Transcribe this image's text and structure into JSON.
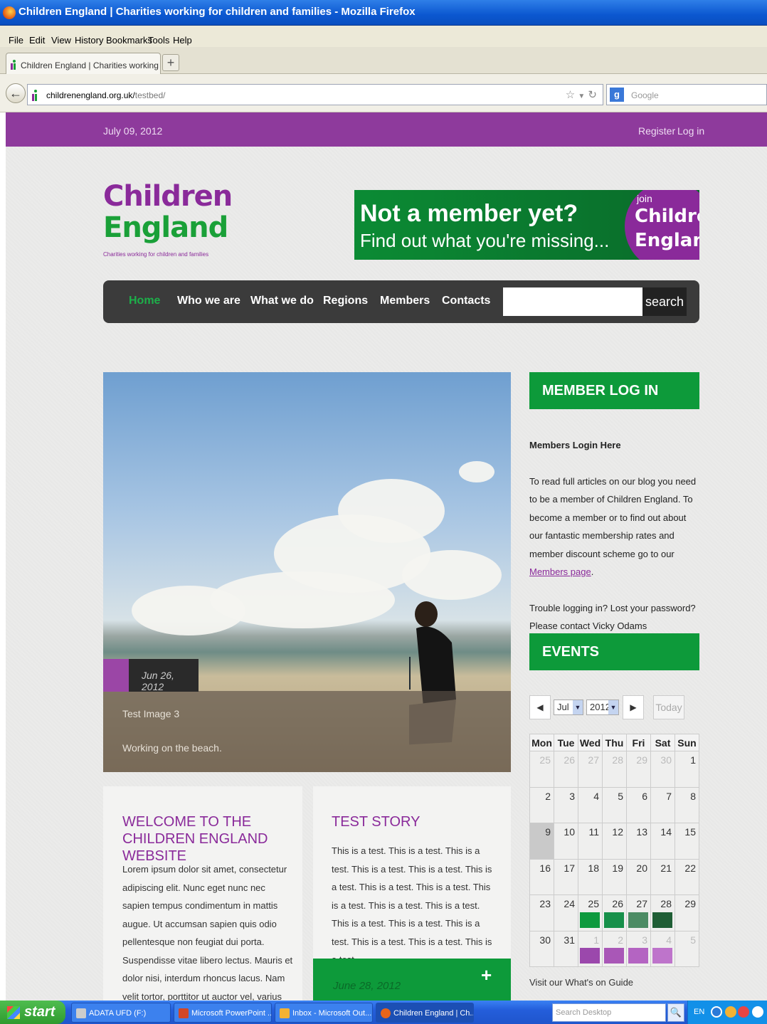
{
  "browser": {
    "window_title": "Children England | Charities working for children and families - Mozilla Firefox",
    "menu": [
      "File",
      "Edit",
      "View",
      "History",
      "Bookmarks",
      "Tools",
      "Help"
    ],
    "tab_title": "Children England | Charities working for child...",
    "new_tab": "+",
    "url_host": "childrenengland.org.uk/",
    "url_path": "testbed/",
    "search_placeholder": "Google",
    "search_engine_letter": "g"
  },
  "page": {
    "date": "July 09, 2012",
    "register": "Register",
    "login": "Log in",
    "logo": {
      "line1": "Children",
      "line2": "England",
      "tagline": "Charities working for children and families"
    },
    "banner": {
      "headline": "Not a member yet?",
      "subline": "Find out what you're missing...",
      "join": "join",
      "c1": "Children",
      "c2": "England"
    },
    "nav": [
      "Home",
      "Who we are",
      "What we do",
      "Regions",
      "Members",
      "Contacts"
    ],
    "search_button": "search",
    "slider": {
      "date": "Jun 26, 2012",
      "title": "Test Image 3",
      "description": "Working on the beach."
    },
    "card1": {
      "title": "WELCOME TO THE CHILDREN ENGLAND WEBSITE",
      "body": "Lorem ipsum dolor sit amet, consectetur adipiscing elit. Nunc eget nunc nec sapien tempus condimentum in mattis augue. Ut accumsan sapien quis odio pellentesque non feugiat dui porta. Suspendisse vitae libero lectus. Mauris et dolor nisi, interdum rhoncus lacus. Nam velit tortor, porttitor ut auctor vel, varius quis mauris. Phasellus enim risus,"
    },
    "card2": {
      "title": "TEST STORY",
      "body": "This is a test. This is a test. This is a test. This is a test. This is a test. This is a test. This is a test. This is a test. This is a test. This is a test. This is a test. This is a test. This is a test. This is a test. This is a test. This is a test. This is a test.",
      "date": "June 28, 2012",
      "plus": "+"
    },
    "sidebar": {
      "member_heading": "MEMBER LOG IN",
      "member_sub": "Members Login Here",
      "member_text": "To read full articles on our blog you need to be a member of Children England. To become a member or to find out about our fantastic membership rates and member discount scheme go to our ",
      "member_link": "Members page",
      "member_text_end": ".",
      "trouble_text": "Trouble logging in? Lost your password? Please contact Vicky Odams (Membership Officer)",
      "events_heading": "EVENTS",
      "cal_month": "Jul",
      "cal_year": "2012",
      "cal_today": "Today",
      "cal_days": [
        "Mon",
        "Tue",
        "Wed",
        "Thu",
        "Fri",
        "Sat",
        "Sun"
      ],
      "cal_weeks": [
        [
          "25",
          "26",
          "27",
          "28",
          "29",
          "30",
          "1"
        ],
        [
          "2",
          "3",
          "4",
          "5",
          "6",
          "7",
          "8"
        ],
        [
          "9",
          "10",
          "11",
          "12",
          "13",
          "14",
          "15"
        ],
        [
          "16",
          "17",
          "18",
          "19",
          "20",
          "21",
          "22"
        ],
        [
          "23",
          "24",
          "25",
          "26",
          "27",
          "28",
          "29"
        ],
        [
          "30",
          "31",
          "1",
          "2",
          "3",
          "4",
          "5"
        ]
      ],
      "whatson": "Visit our What's on Guide"
    }
  },
  "taskbar": {
    "start": "start",
    "items": [
      "ADATA UFD (F:)",
      "Microsoft PowerPoint ...",
      "Inbox - Microsoft Out...",
      "Children England | Ch..."
    ],
    "search_desktop": "Search Desktop",
    "lang": "EN"
  },
  "colors": {
    "purple": "#8e3a9c",
    "green": "#0d9a3a",
    "nav_bg": "#3b3b3b",
    "event_green": [
      "#0e9a3e",
      "#17904a",
      "#4c8c64",
      "#1f5e35"
    ],
    "event_purple": [
      "#9b48ac",
      "#a957b7",
      "#b464c2",
      "#be74cb"
    ]
  }
}
